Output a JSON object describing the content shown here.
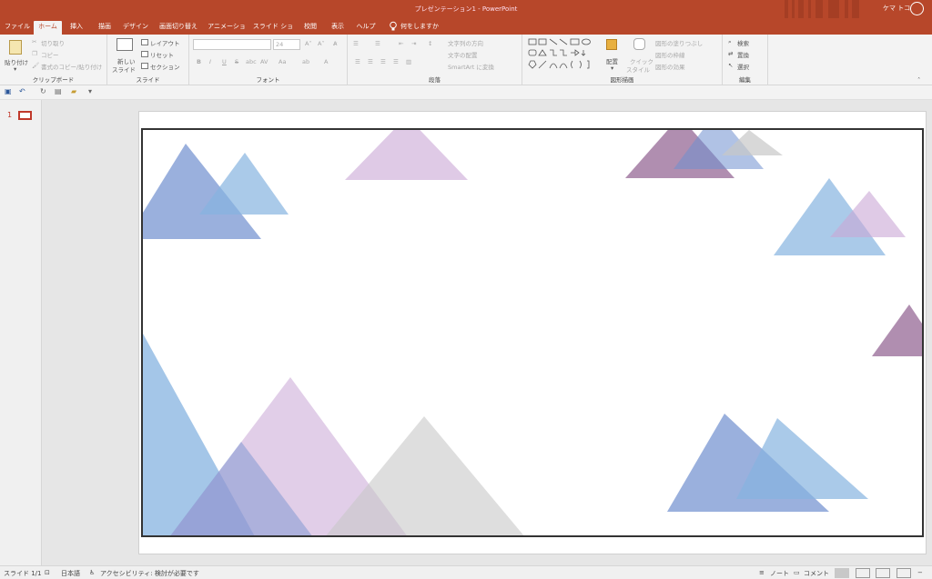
{
  "title_bar": {
    "document": "プレゼンテーション1 - PowerPoint",
    "user_name": "ケマ トコ"
  },
  "tabs": [
    "ファイル",
    "ホーム",
    "挿入",
    "描画",
    "デザイン",
    "画面切り替え",
    "アニメーション",
    "スライド ショー",
    "校閲",
    "表示",
    "ヘルプ",
    "何をしますか"
  ],
  "ribbon": {
    "clipboard": {
      "label": "クリップボード",
      "paste": "貼り付け",
      "cut": "切り取り",
      "copy": "コピー",
      "format_painter": "書式のコピー/貼り付け"
    },
    "slides": {
      "label": "スライド",
      "new_slide_1": "新しい",
      "new_slide_2": "スライド",
      "layout": "レイアウト",
      "reset": "リセット",
      "section": "セクション"
    },
    "font": {
      "label": "フォント",
      "size": "24"
    },
    "paragraph": {
      "label": "段落",
      "text_direction": "文字列の方向",
      "align_text": "文字の配置",
      "smartart": "SmartArt に変換"
    },
    "drawing": {
      "label": "図形描画",
      "arrange": "配置",
      "quick_styles_1": "クイック",
      "quick_styles_2": "スタイル",
      "shape_fill": "図形の塗りつぶし",
      "shape_outline": "図形の枠線",
      "shape_effects": "図形の効果"
    },
    "editing": {
      "label": "編集",
      "find": "検索",
      "replace": "置換",
      "select": "選択"
    }
  },
  "thumbnail": {
    "number": "1"
  },
  "status": {
    "slide": "スライド 1/1",
    "language": "日本語",
    "accessibility": "アクセシビリティ: 検討が必要です",
    "notes": "ノート",
    "comments": "コメント"
  },
  "colors": {
    "brand": "#b7472a",
    "blue_dark": "#6f8fcf",
    "blue_light": "#86b3e0",
    "pink": "#c9a6d6",
    "purple": "#8e5e8e",
    "gray": "#c8c8c8"
  }
}
